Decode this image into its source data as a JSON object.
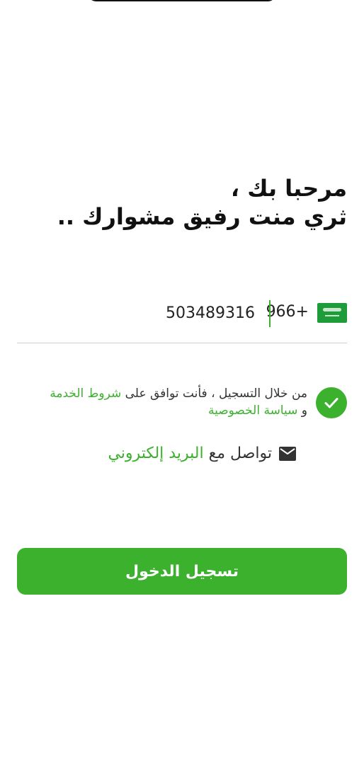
{
  "greeting": {
    "line1": "مرحبا بك ،",
    "line2": "ثري منت رفيق مشوارك .."
  },
  "phone": {
    "country": "Saudi Arabia",
    "dial_code": "966+",
    "number": "503489316"
  },
  "consent": {
    "prefix": "من خلال التسجيل ، فأنت توافق على",
    "terms_link": "شروط الخدمة",
    "conjunction": "و",
    "privacy_link": "سياسة الخصوصية",
    "checked": true
  },
  "contact": {
    "prefix": "تواصل مع",
    "email_link": "البريد إلكتروني"
  },
  "login": {
    "label": "تسجيل الدخول"
  },
  "colors": {
    "accent": "#3cb12e",
    "text": "#111111",
    "divider": "#cfcfcf"
  },
  "icons": {
    "flag": "saudi-flag-icon",
    "check": "check-icon",
    "mail": "mail-icon"
  }
}
